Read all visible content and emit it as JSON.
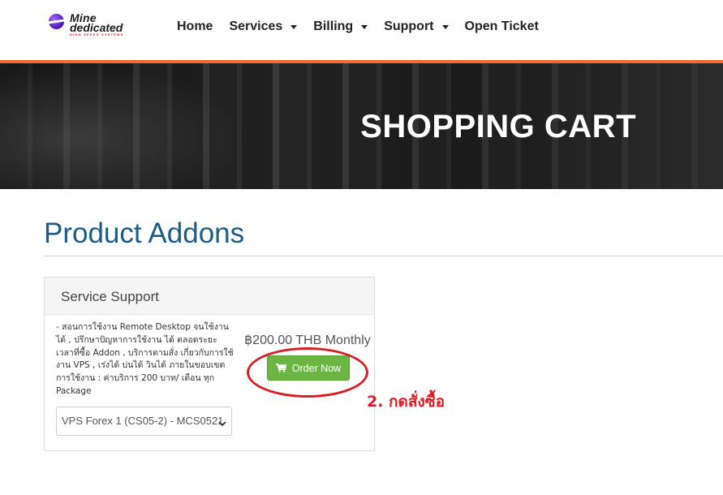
{
  "brand": {
    "line1": "Mine",
    "line2": "dedicated",
    "tagline": "HIGH SPEED SYSTEMS"
  },
  "nav": {
    "items": [
      {
        "label": "Home",
        "dropdown": false
      },
      {
        "label": "Services",
        "dropdown": true
      },
      {
        "label": "Billing",
        "dropdown": true
      },
      {
        "label": "Support",
        "dropdown": true
      },
      {
        "label": "Open Ticket",
        "dropdown": false
      }
    ]
  },
  "banner": {
    "title": "SHOPPING CART"
  },
  "page": {
    "title": "Product Addons"
  },
  "addon": {
    "name": "Service Support",
    "description": "- สอนการใช้งาน Remote Desktop จนใช้งานได้ , ปรึกษาปัญหาการใช้งาน ได้ ตลอดระยะเวลาที่ซื้อ Addon , บริการตามสั่ง เกี่ยวกับการใช้งาน VPS , เร่งได้ บ่นได้ วินได้ ภายในขอบเขตการใช้งาน : ค่าบริการ 200 บาท/ เดือน ทุก Package",
    "price": "฿200.00 THB Monthly",
    "order_button": "Order Now",
    "selected_service": "VPS Forex 1 (CS05-2) - MCS0521"
  },
  "annotation": {
    "note": "2. กดสั่งซื้อ"
  },
  "colors": {
    "accent_orange": "#f46a30",
    "title_blue": "#1e5b86",
    "button_green": "#6bb543",
    "annotation_red": "#d81f26"
  }
}
